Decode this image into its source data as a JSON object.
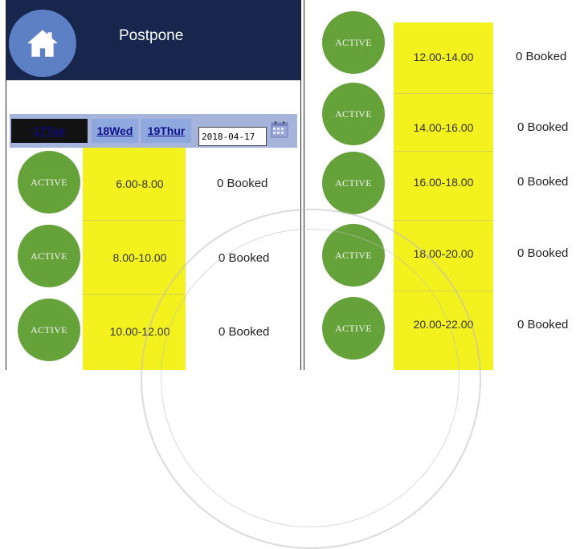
{
  "header": {
    "title": "Postpone"
  },
  "date_bar": {
    "days": [
      {
        "label": "17Tue"
      },
      {
        "label": "18Wed"
      },
      {
        "label": "19Thur"
      }
    ],
    "date_value": "2018-04-17"
  },
  "left_slots": [
    {
      "status": "ACTIVE",
      "time": "6.00-8.00",
      "booked": "0 Booked"
    },
    {
      "status": "ACTIVE",
      "time": "8.00-10.00",
      "booked": "0 Booked"
    },
    {
      "status": "ACTIVE",
      "time": "10.00-12.00",
      "booked": "0 Booked"
    }
  ],
  "right_slots": [
    {
      "status": "ACTIVE",
      "time": "12.00-14.00",
      "booked": "0 Booked"
    },
    {
      "status": "ACTIVE",
      "time": "14.00-16.00",
      "booked": "0 Booked"
    },
    {
      "status": "ACTIVE",
      "time": "16.00-18.00",
      "booked": "0 Booked"
    },
    {
      "status": "ACTIVE",
      "time": "18.00-20.00",
      "booked": "0 Booked"
    },
    {
      "status": "ACTIVE",
      "time": "20.00-22.00",
      "booked": "0 Booked"
    }
  ],
  "icons": {
    "home": "home-icon",
    "calendar": "calendar-icon"
  },
  "colors": {
    "header": "#16264d",
    "active": "#66a23a",
    "slot": "#f4f21e",
    "date_bar": "#a6b3da"
  }
}
